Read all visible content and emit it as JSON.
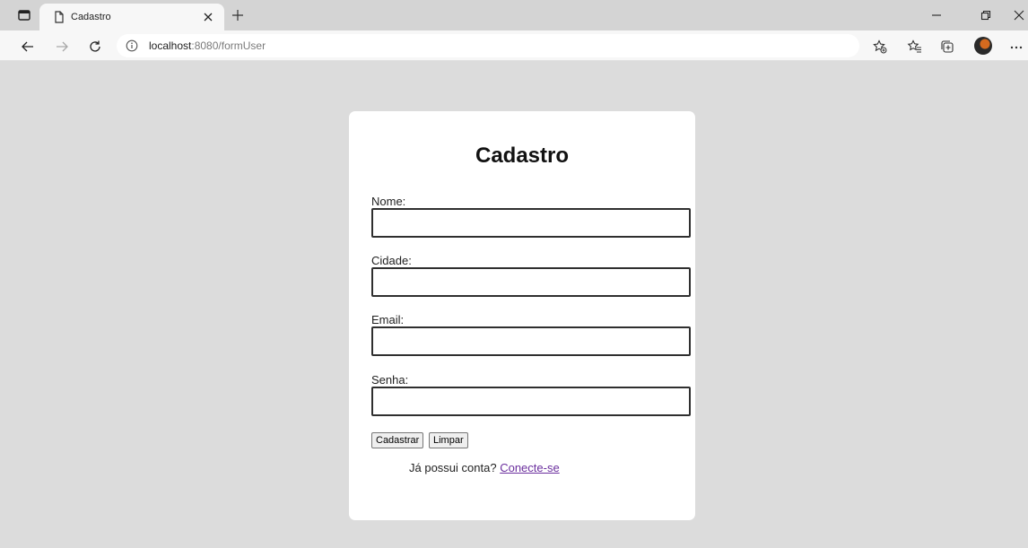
{
  "browser": {
    "tab_title": "Cadastro",
    "url_host": "localhost",
    "url_rest": ":8080/formUser"
  },
  "form": {
    "title": "Cadastro",
    "fields": [
      {
        "label": "Nome:",
        "value": ""
      },
      {
        "label": "Cidade:",
        "value": ""
      },
      {
        "label": "Email:",
        "value": ""
      },
      {
        "label": "Senha:",
        "value": ""
      }
    ],
    "submit_label": "Cadastrar",
    "reset_label": "Limpar",
    "login_prompt": "Já possui conta?",
    "login_link": "Conecte-se"
  },
  "colors": {
    "page_bg": "#dcdcdc",
    "card_bg": "#ffffff",
    "link_visited": "#6b2f9e"
  }
}
